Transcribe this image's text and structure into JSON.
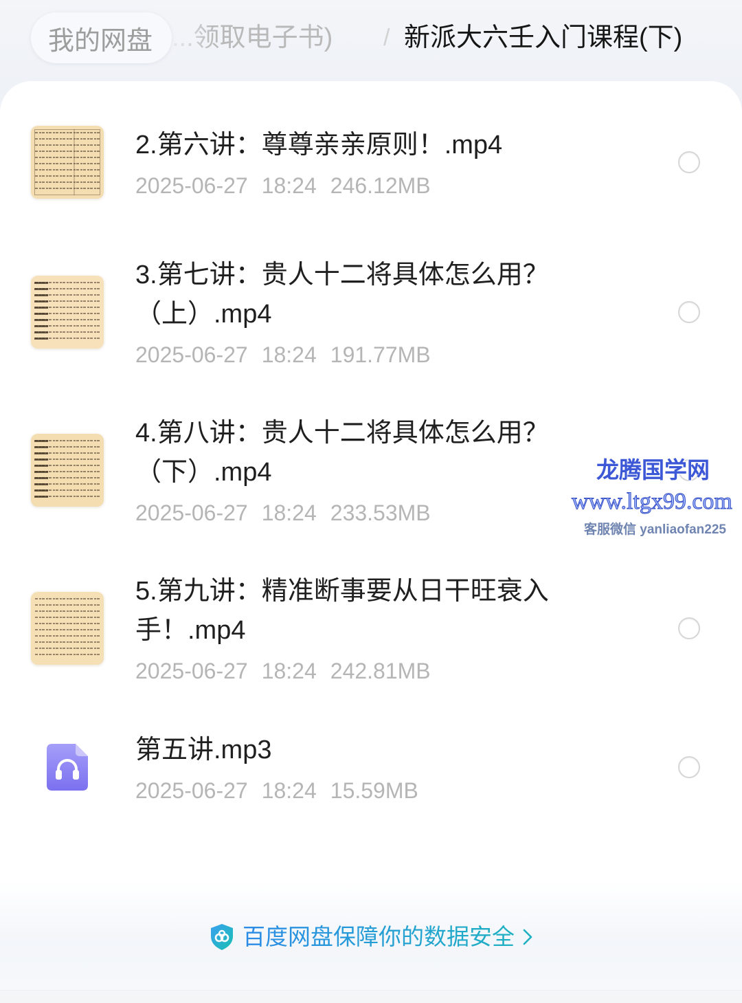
{
  "breadcrumb": {
    "root_label": "我的网盘",
    "parent_label": "...领取电子书)",
    "separator": "/",
    "current_label": "新派大六壬入门课程(下)"
  },
  "files": [
    {
      "name": "2.第六讲：尊尊亲亲原则！.mp4",
      "date": "2025-06-27",
      "time": "18:24",
      "size": "246.12MB",
      "icon": "video-thumbnail",
      "selected": false
    },
    {
      "name": "3.第七讲：贵人十二将具体怎么用？（上）.mp4",
      "date": "2025-06-27",
      "time": "18:24",
      "size": "191.77MB",
      "icon": "video-thumbnail",
      "selected": false
    },
    {
      "name": "4.第八讲：贵人十二将具体怎么用？（下）.mp4",
      "date": "2025-06-27",
      "time": "18:24",
      "size": "233.53MB",
      "icon": "video-thumbnail",
      "selected": false
    },
    {
      "name": "5.第九讲：精准断事要从日干旺衰入手！.mp4",
      "date": "2025-06-27",
      "time": "18:24",
      "size": "242.81MB",
      "icon": "video-thumbnail",
      "selected": false
    },
    {
      "name": "第五讲.mp3",
      "date": "2025-06-27",
      "time": "18:24",
      "size": "15.59MB",
      "icon": "audio-file-icon",
      "selected": false
    }
  ],
  "watermark": {
    "brand": "龙腾国学网",
    "site": "www.ltgx99.com",
    "contact": "客服微信 yanliaofan225"
  },
  "security_banner": {
    "text": "百度网盘保障你的数据安全",
    "icon": "shield-icon",
    "trailing_icon": "chevron-right-icon"
  },
  "colors": {
    "page_background": "#eff2f7",
    "card_background": "#ffffff",
    "title_text": "#1f1f1f",
    "meta_text": "#b5b5b5",
    "banner_accent_start": "#2b8be6",
    "banner_accent_end": "#1fb0c2",
    "audio_icon": "#8a81f3",
    "thumbnail_paper": "#f4ddb1",
    "watermark_blue": "#3c58d6"
  }
}
